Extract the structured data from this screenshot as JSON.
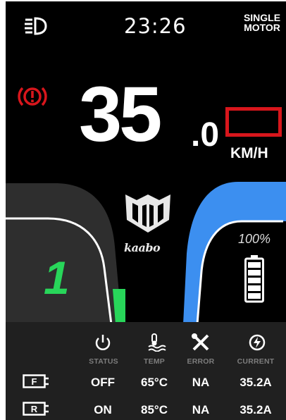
{
  "header": {
    "time": "23:26",
    "motor_mode_line1": "SINGLE",
    "motor_mode_line2": "MOTOR",
    "headlight_icon": "headlight-icon"
  },
  "warning": {
    "icon": "brake-warning-icon",
    "color": "#d8161c"
  },
  "speed": {
    "integer": "35",
    "decimal": ".0",
    "unit": "KM/H"
  },
  "gear": {
    "value": "1",
    "color": "#28d65a"
  },
  "brand": {
    "name": "kaabo"
  },
  "battery": {
    "percent_text": "100%",
    "level": 1.0
  },
  "telemetry": {
    "headers": [
      "STATUS",
      "TEMP",
      "ERROR",
      "CURRENT"
    ],
    "icons": [
      "power-icon",
      "temperature-icon",
      "wrench-icon",
      "lightning-icon"
    ],
    "rows": [
      {
        "tag": "F",
        "status": "OFF",
        "temp": "65°C",
        "error": "NA",
        "current": "35.2A"
      },
      {
        "tag": "R",
        "status": "ON",
        "temp": "85°C",
        "error": "NA",
        "current": "35.2A"
      }
    ]
  },
  "colors": {
    "accent_blue": "#3c8ff0",
    "accent_green": "#28d65a",
    "warning_red": "#d8161c"
  }
}
